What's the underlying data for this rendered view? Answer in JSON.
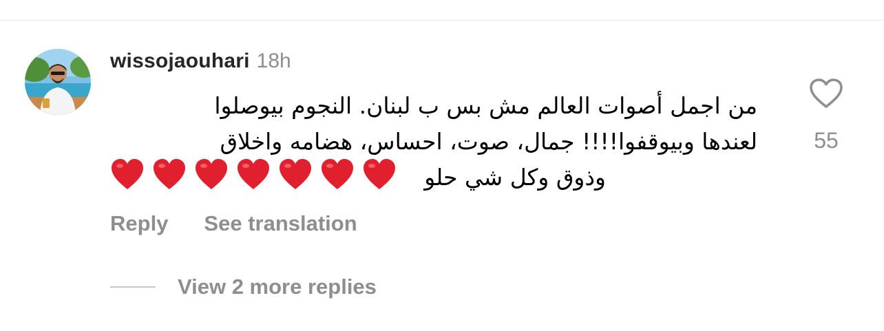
{
  "comment": {
    "username": "wissojaouhari",
    "timestamp": "18h",
    "text_lines": [
      "من اجمل أصوات العالم مش بس ب لبنان. النجوم بيوصلوا",
      "لعندها وبيوقفوا!!!! جمال، صوت، احساس، هضامه واخلاق",
      "وذوق وكل شي حلو"
    ],
    "emoji": [
      "❤️",
      "❤️",
      "❤️",
      "❤️",
      "❤️",
      "❤️",
      "❤️"
    ],
    "like_count": "55",
    "like_icon": "heart-outline-icon"
  },
  "actions": {
    "reply_label": "Reply",
    "translate_label": "See translation"
  },
  "replies": {
    "label": "View 2 more replies"
  },
  "colors": {
    "muted_text": "#8e8e8e",
    "username": "#262626",
    "heart_emoji": "#e0202e",
    "divider": "#e6e6e6"
  }
}
